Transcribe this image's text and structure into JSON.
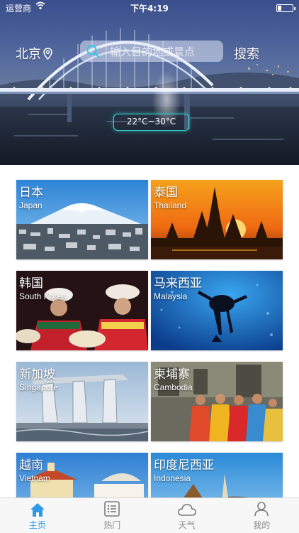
{
  "status_bar": {
    "carrier": "运营商",
    "time": "下午4:19"
  },
  "header": {
    "city": "北京",
    "search_placeholder": "输入目的地或景点",
    "search_button": "搜索",
    "weather": "22°C~30°C"
  },
  "destinations": [
    {
      "name": "日本",
      "name_en": "Japan"
    },
    {
      "name": "泰国",
      "name_en": "Thailand"
    },
    {
      "name": "韩国",
      "name_en": "South Korea"
    },
    {
      "name": "马来西亚",
      "name_en": "Malaysia"
    },
    {
      "name": "新加坡",
      "name_en": "Singapore"
    },
    {
      "name": "柬埔寨",
      "name_en": "Cambodia"
    },
    {
      "name": "越南",
      "name_en": "Vietnam"
    },
    {
      "name": "印度尼西亚",
      "name_en": "Indonesia"
    }
  ],
  "tabbar": {
    "items": [
      {
        "label": "主页",
        "icon": "home-icon",
        "active": true
      },
      {
        "label": "热门",
        "icon": "list-icon",
        "active": false
      },
      {
        "label": "天气",
        "icon": "cloud-icon",
        "active": false
      },
      {
        "label": "我的",
        "icon": "person-icon",
        "active": false
      }
    ]
  },
  "colors": {
    "accent": "#2e9be6",
    "weather_border": "#35d7d0"
  }
}
